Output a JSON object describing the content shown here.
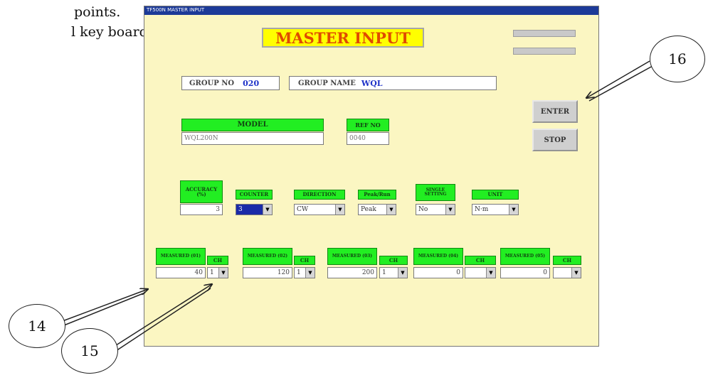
{
  "doc": {
    "line1": "points.",
    "line2": "l key board."
  },
  "window": {
    "title": "TF500N MASTER INPUT"
  },
  "header": {
    "title": "MASTER INPUT"
  },
  "group": {
    "no_label": "GROUP NO",
    "no_value": "020",
    "name_label": "GROUP NAME",
    "name_value": "WQL"
  },
  "model": {
    "label": "MODEL",
    "value": "WQL200N",
    "ref_label": "REF NO",
    "ref_value": "0040"
  },
  "buttons": {
    "enter": "ENTER",
    "stop": "STOP"
  },
  "settings": {
    "accuracy_label": "ACCURACY (%)",
    "accuracy_value": "3",
    "counter_label": "COUNTER",
    "counter_value": "3",
    "direction_label": "DIRECTION",
    "direction_value": "CW",
    "peak_label": "Peak/Run",
    "peak_value": "Peak",
    "single_label": "SINGLE SETTING",
    "single_value": "No",
    "unit_label": "UNIT",
    "unit_value": "N·m"
  },
  "measured": [
    {
      "label": "MEASURED (01)",
      "value": "40",
      "ch_label": "CH",
      "ch": "1"
    },
    {
      "label": "MEASURED (02)",
      "value": "120",
      "ch_label": "CH",
      "ch": "1"
    },
    {
      "label": "MEASURED (03)",
      "value": "200",
      "ch_label": "CH",
      "ch": "1"
    },
    {
      "label": "MEASURED (04)",
      "value": "0",
      "ch_label": "CH",
      "ch": ""
    },
    {
      "label": "MEASURED (05)",
      "value": "0",
      "ch_label": "CH",
      "ch": ""
    }
  ],
  "callouts": {
    "c14": "14",
    "c15": "15",
    "c16": "16"
  },
  "colors": {
    "panel": "#fbf6c2",
    "green": "#22ee22",
    "title_yellow": "#ffff00",
    "title_text": "#e04b00",
    "value_blue": "#1e32c8"
  }
}
